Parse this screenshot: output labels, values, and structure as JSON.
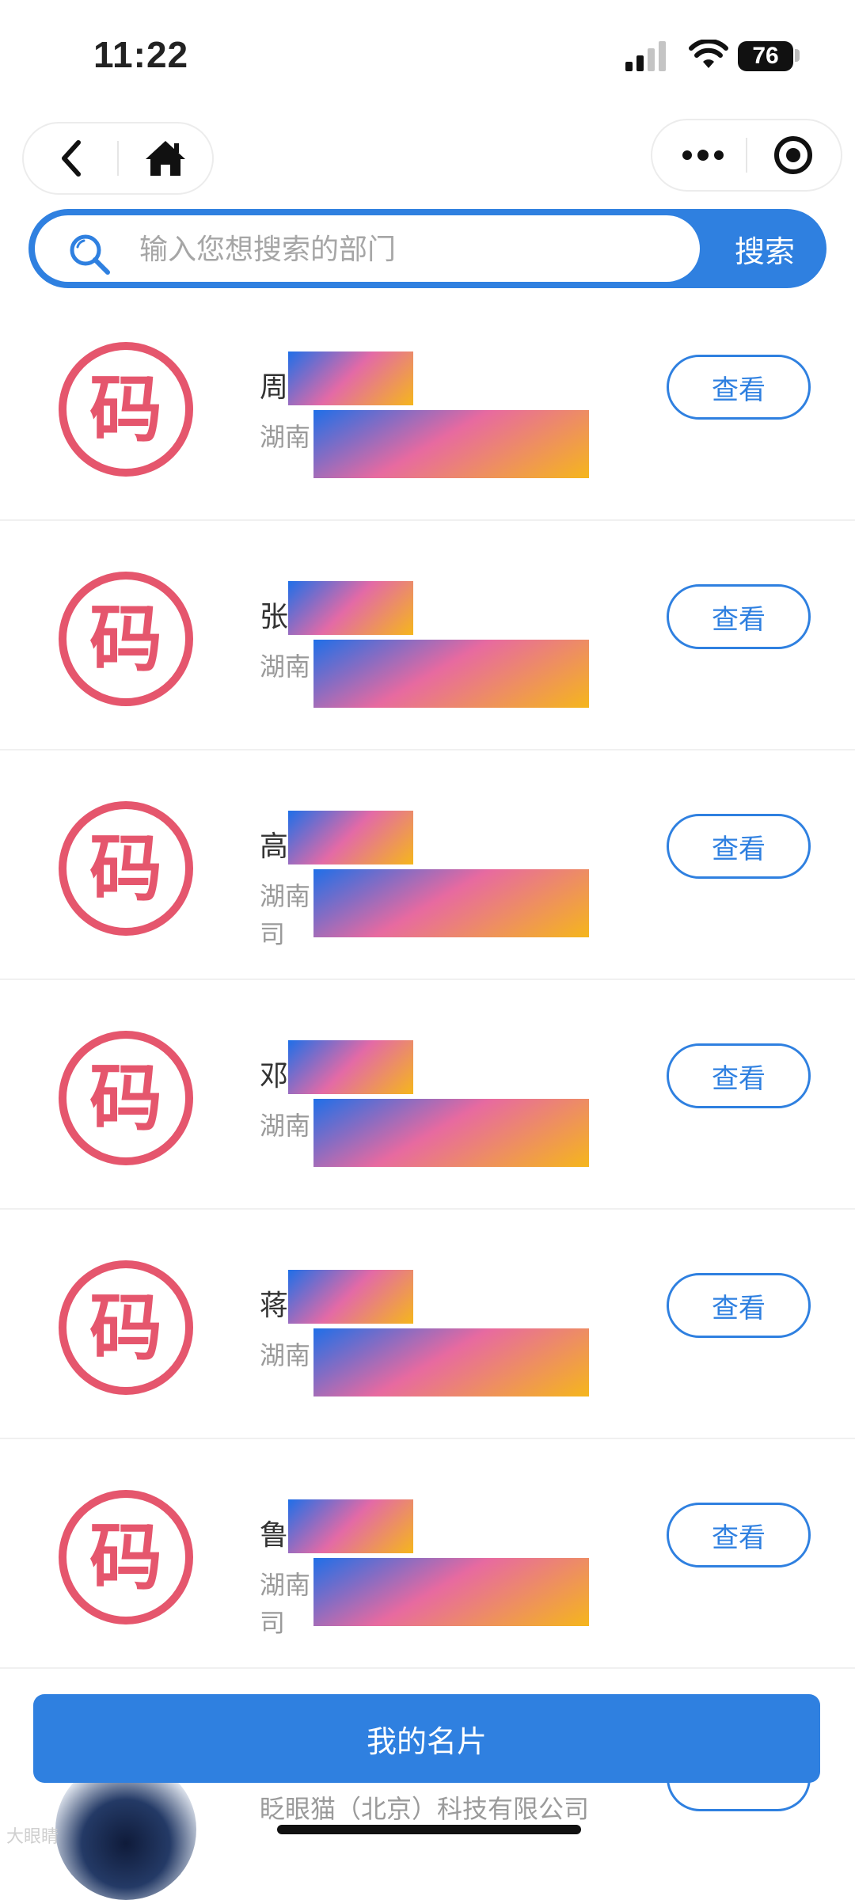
{
  "status_bar": {
    "time": "11:22",
    "battery": "76"
  },
  "capsule": {
    "back_icon": "chevron-left-icon",
    "home_icon": "home-icon",
    "more_icon": "more-dots-icon",
    "target_icon": "target-icon"
  },
  "search": {
    "placeholder": "输入您想搜索的部门",
    "value": "",
    "button_label": "搜索"
  },
  "list": {
    "items": [
      {
        "name": "周",
        "company_line1": "湖南",
        "company_line2": "",
        "view_label": "查看"
      },
      {
        "name": "张",
        "company_line1": "湖南",
        "company_line2": "",
        "view_label": "查看"
      },
      {
        "name": "高",
        "company_line1": "湖南                                限公",
        "company_line2": "司",
        "view_label": "查看"
      },
      {
        "name": "邓",
        "company_line1": "湖南",
        "company_line2": "",
        "view_label": "查看"
      },
      {
        "name": "蒋",
        "company_line1": "湖南",
        "company_line2": "",
        "view_label": "查看"
      },
      {
        "name": "鲁",
        "company_line1": "湖南                                限公",
        "company_line2": "司",
        "view_label": "查看"
      }
    ],
    "peek_company": "眨眼猫（北京）科技有限公司"
  },
  "footer": {
    "card_button_label": "我的名片"
  },
  "avatar_text": "码",
  "watermark": "大眼睛",
  "colors": {
    "accent": "#2f80e0",
    "stamp": "#e5566d"
  }
}
